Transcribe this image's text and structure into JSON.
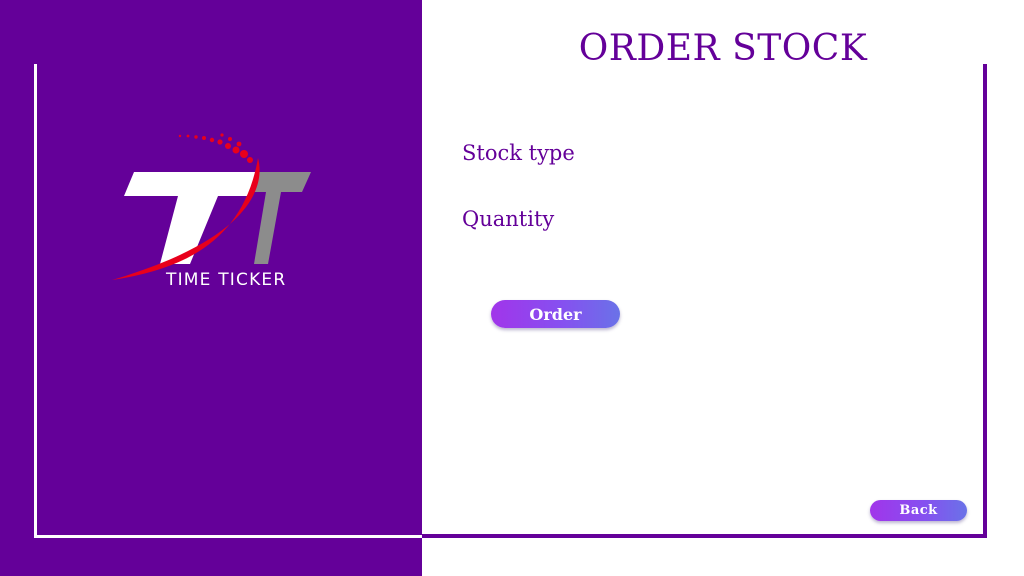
{
  "app": {
    "logo_text": "TIME TICKER",
    "logo_icon": "time-ticker-logo",
    "colors": {
      "brand_purple": "#640099",
      "button_start": "#a135ea",
      "button_end": "#6a72e8",
      "logo_red": "#e8001c",
      "logo_gray": "#8c8c8c"
    }
  },
  "form": {
    "title": "ORDER STOCK",
    "stock_type_label": "Stock type",
    "quantity_label": "Quantity",
    "order_button": "Order",
    "back_button": "Back"
  }
}
